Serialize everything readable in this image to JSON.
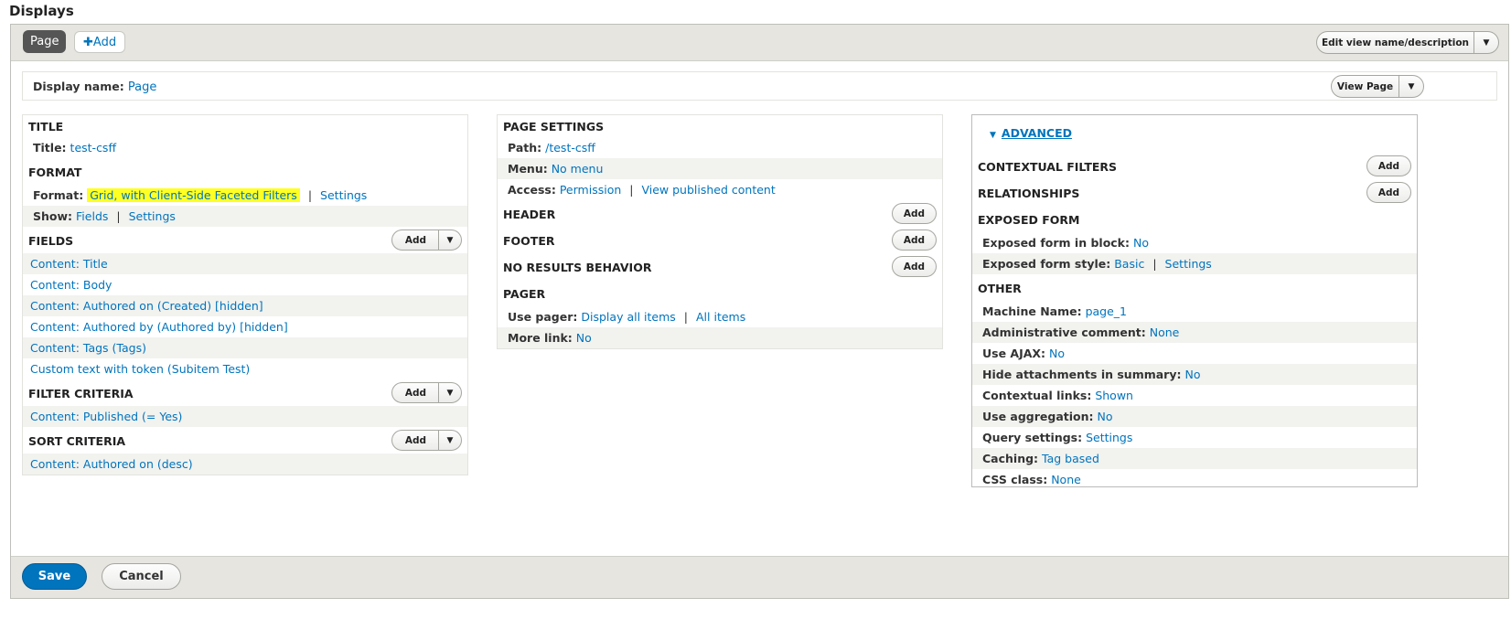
{
  "heading": "Displays",
  "tabs": {
    "active": "Page",
    "add": "Add"
  },
  "edit_view": {
    "label": "Edit view name/description"
  },
  "display_name": {
    "label": "Display name:",
    "value": "Page",
    "view_page": "View Page"
  },
  "col1": {
    "title": {
      "heading": "TITLE",
      "label": "Title:",
      "value": "test-csff"
    },
    "format": {
      "heading": "FORMAT",
      "format_label": "Format:",
      "format_value": "Grid, with Client-Side Faceted Filters",
      "settings": "Settings",
      "show_label": "Show:",
      "show_value": "Fields",
      "show_settings": "Settings"
    },
    "fields": {
      "heading": "FIELDS",
      "add": "Add",
      "items": [
        "Content: Title",
        "Content: Body",
        "Content: Authored on (Created) [hidden]",
        "Content: Authored by (Authored by) [hidden]",
        "Content: Tags (Tags)",
        "Custom text with token (Subitem Test)"
      ]
    },
    "filter": {
      "heading": "FILTER CRITERIA",
      "add": "Add",
      "items": [
        "Content: Published (= Yes)"
      ]
    },
    "sort": {
      "heading": "SORT CRITERIA",
      "add": "Add",
      "items": [
        "Content: Authored on (desc)"
      ]
    }
  },
  "col2": {
    "page_settings": {
      "heading": "PAGE SETTINGS",
      "path_label": "Path:",
      "path_value": "/test-csff",
      "menu_label": "Menu:",
      "menu_value": "No menu",
      "access_label": "Access:",
      "access_value": "Permission",
      "access_link": "View published content"
    },
    "header": {
      "heading": "HEADER",
      "add": "Add"
    },
    "footer": {
      "heading": "FOOTER",
      "add": "Add"
    },
    "no_results": {
      "heading": "NO RESULTS BEHAVIOR",
      "add": "Add"
    },
    "pager": {
      "heading": "PAGER",
      "use_label": "Use pager:",
      "use_value": "Display all items",
      "use_link": "All items",
      "more_label": "More link:",
      "more_value": "No"
    }
  },
  "col3": {
    "advanced": "ADVANCED",
    "contextual": {
      "heading": "CONTEXTUAL FILTERS",
      "add": "Add"
    },
    "relationships": {
      "heading": "RELATIONSHIPS",
      "add": "Add"
    },
    "exposed": {
      "heading": "EXPOSED FORM",
      "block_label": "Exposed form in block:",
      "block_value": "No",
      "style_label": "Exposed form style:",
      "style_value": "Basic",
      "style_settings": "Settings"
    },
    "other": {
      "heading": "OTHER",
      "rows": [
        {
          "label": "Machine Name:",
          "value": "page_1"
        },
        {
          "label": "Administrative comment:",
          "value": "None"
        },
        {
          "label": "Use AJAX:",
          "value": "No"
        },
        {
          "label": "Hide attachments in summary:",
          "value": "No"
        },
        {
          "label": "Contextual links:",
          "value": "Shown"
        },
        {
          "label": "Use aggregation:",
          "value": "No"
        },
        {
          "label": "Query settings:",
          "value": "Settings"
        },
        {
          "label": "Caching:",
          "value": "Tag based"
        },
        {
          "label": "CSS class:",
          "value": "None"
        }
      ]
    }
  },
  "footer": {
    "save": "Save",
    "cancel": "Cancel"
  },
  "colors": {
    "link": "#0074bd",
    "highlight": "#ffff22",
    "bar": "#e6e5e0",
    "primary": "#0074bd"
  }
}
